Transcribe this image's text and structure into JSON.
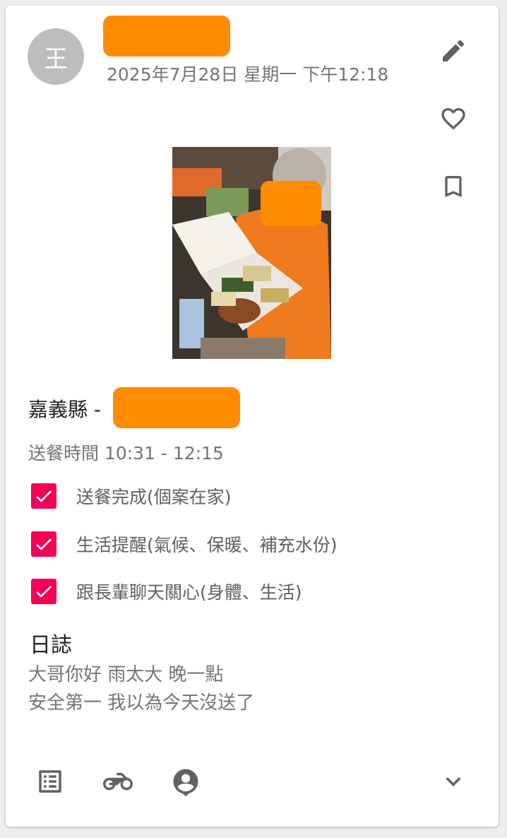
{
  "header": {
    "avatar_letter": "王",
    "date_text": "2025年7月28日 星期一 下午12:18"
  },
  "actions": {
    "edit_icon": "pencil-icon",
    "like_icon": "heart-outline-icon",
    "bookmark_icon": "bookmark-outline-icon"
  },
  "location": {
    "county_prefix": "嘉義縣 -"
  },
  "delivery": {
    "time_text": "送餐時間 10:31 - 12:15"
  },
  "checklist": [
    {
      "label": "送餐完成(個案在家)",
      "checked": true
    },
    {
      "label": "生活提醒(氣候、保暖、補充水份)",
      "checked": true
    },
    {
      "label": "跟長輩聊天關心(身體、生活)",
      "checked": true
    }
  ],
  "log": {
    "title": "日誌",
    "lines": [
      "大哥你好 雨太大 晚一點",
      "安全第一 我以為今天沒送了"
    ]
  },
  "footer": {
    "icons": [
      "list-icon",
      "motorcycle-icon",
      "account-pin-icon",
      "chevron-down-icon"
    ]
  },
  "colors": {
    "accent": "#f50057",
    "redaction": "#ff8c00",
    "avatar_bg": "#bdbdbd",
    "icon": "#616161",
    "secondary_text": "#757575"
  }
}
